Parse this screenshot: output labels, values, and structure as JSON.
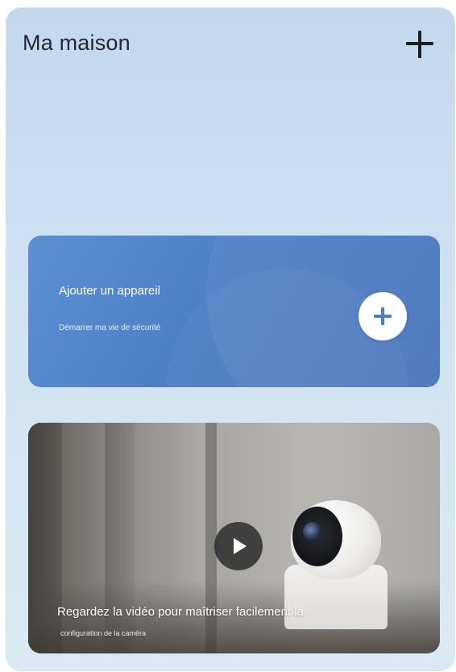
{
  "header": {
    "title": "Ma maison",
    "add_icon": "plus-icon"
  },
  "add_device_card": {
    "title": "Ajouter un appareil",
    "subtitle": "Démarrer ma vie de sécurité",
    "icon": "plus-icon",
    "accent_color": "#4d7fc5"
  },
  "video_card": {
    "title": "Regardez la vidéo pour maîtriser facilement la",
    "subtitle": "configuration de la caméra",
    "play_icon": "play-icon"
  }
}
